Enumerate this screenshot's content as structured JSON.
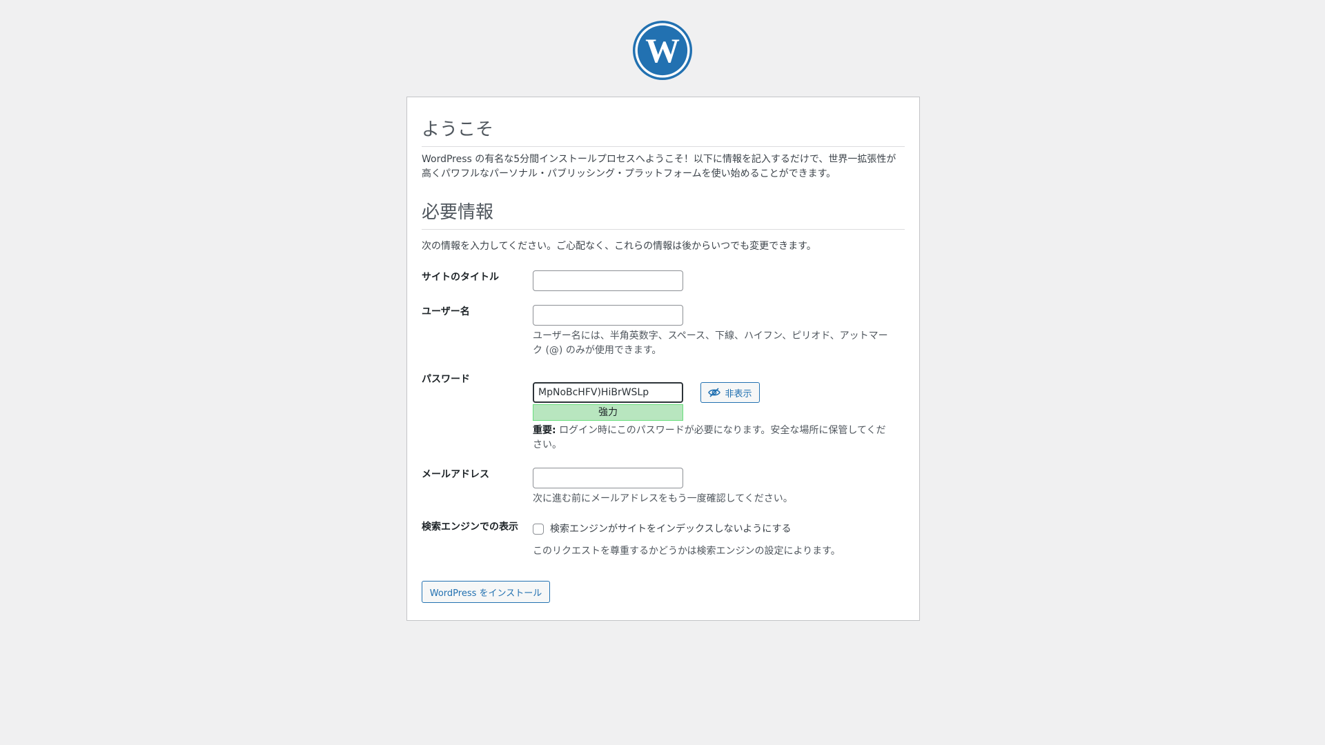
{
  "logo": {
    "icon": "wordpress-logo-icon",
    "color": "#2271b1"
  },
  "welcome": {
    "title": "ようこそ",
    "intro": "WordPress の有名な5分間インストールプロセスへようこそ！以下に情報を記入するだけで、世界一拡張性が高くパワフルなパーソナル・パブリッシング・プラットフォームを使い始めることができます。"
  },
  "required": {
    "title": "必要情報",
    "intro": "次の情報を入力してください。ご心配なく、これらの情報は後からいつでも変更できます。"
  },
  "fields": {
    "site_title": {
      "label": "サイトのタイトル",
      "value": ""
    },
    "username": {
      "label": "ユーザー名",
      "value": "",
      "hint": "ユーザー名には、半角英数字、スペース、下線、ハイフン、ピリオド、アットマーク (@) のみが使用できます。"
    },
    "password": {
      "label": "パスワード",
      "value": "MpNoBcHFV)HiBrWSLp",
      "hide_button": "非表示",
      "strength": "強力",
      "hint_bold": "重要:",
      "hint": "ログイン時にこのパスワードが必要になります。安全な場所に保管してください。"
    },
    "email": {
      "label": "メールアドレス",
      "value": "",
      "hint": "次に進む前にメールアドレスをもう一度確認してください。"
    },
    "search_engine": {
      "label": "検索エンジンでの表示",
      "checkbox_label": "検索エンジンがサイトをインデックスしないようにする",
      "checked": false,
      "hint": "このリクエストを尊重するかどうかは検索エンジンの設定によります。"
    }
  },
  "install_button": "WordPress をインストール",
  "colors": {
    "accent": "#2271b1",
    "strength_bg": "#b8e6bf"
  }
}
